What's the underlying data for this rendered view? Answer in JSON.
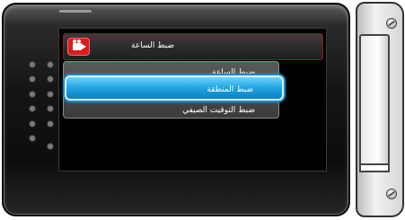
{
  "menu": {
    "title": "ضبط الساعة",
    "items": [
      {
        "label": "ضبط الساعة",
        "selected": false
      },
      {
        "label": "ضبط المنطقة",
        "selected": true
      },
      {
        "label": "ضبط التوقيت الصيفي",
        "selected": false
      }
    ],
    "title_icon": "video-camera-icon"
  },
  "colors": {
    "accent": "#1b87c4",
    "title_icon_bg": "#d71d1d",
    "screen_bg": "#000000"
  }
}
